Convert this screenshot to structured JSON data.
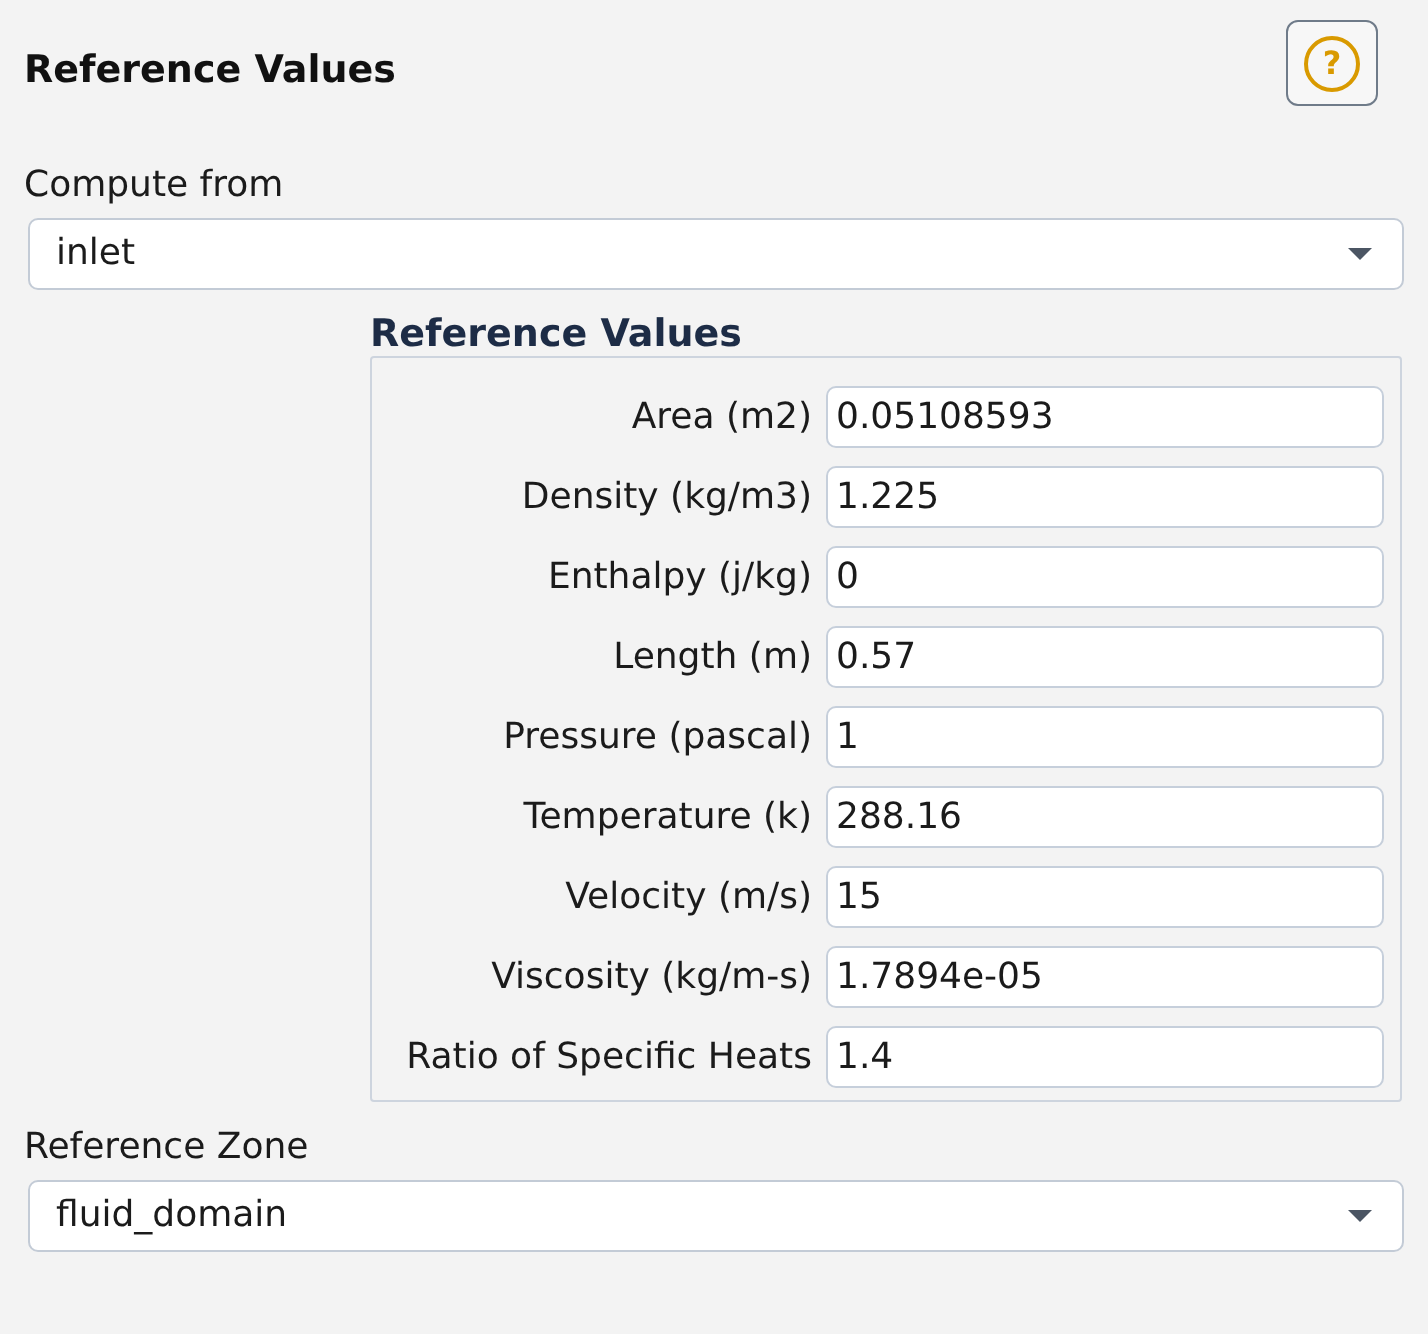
{
  "title": "Reference Values",
  "help_button": {
    "symbol": "?"
  },
  "compute_from": {
    "label": "Compute from",
    "value": "inlet"
  },
  "reference_values": {
    "title": "Reference Values",
    "fields": [
      {
        "label": "Area (m2)",
        "value": "0.05108593"
      },
      {
        "label": "Density (kg/m3)",
        "value": "1.225"
      },
      {
        "label": "Enthalpy (j/kg)",
        "value": "0"
      },
      {
        "label": "Length (m)",
        "value": "0.57"
      },
      {
        "label": "Pressure (pascal)",
        "value": "1"
      },
      {
        "label": "Temperature (k)",
        "value": "288.16"
      },
      {
        "label": "Velocity (m/s)",
        "value": "15"
      },
      {
        "label": "Viscosity (kg/m-s)",
        "value": "1.7894e-05"
      },
      {
        "label": "Ratio of Specific Heats",
        "value": "1.4"
      }
    ]
  },
  "reference_zone": {
    "label": "Reference Zone",
    "value": "fluid_domain"
  }
}
